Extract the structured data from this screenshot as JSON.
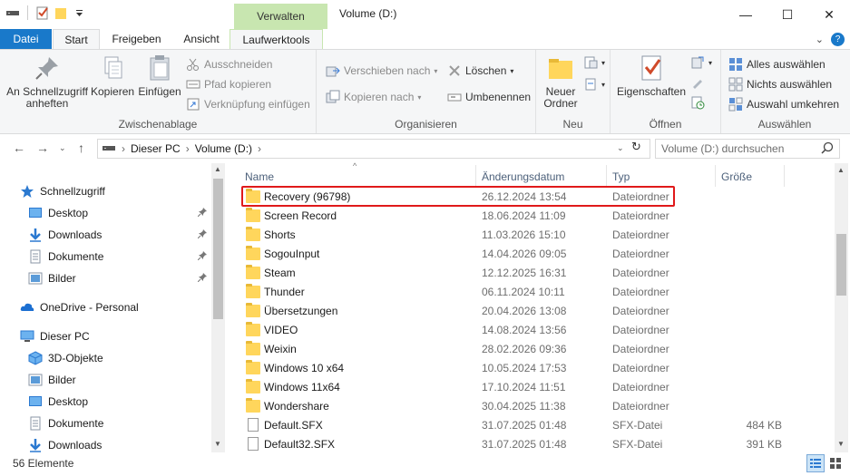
{
  "window": {
    "title": "Volume (D:)",
    "tool_tab": "Verwalten",
    "minimize": "—",
    "maximize": "☐",
    "close": "✕"
  },
  "tabs": {
    "file": "Datei",
    "start": "Start",
    "share": "Freigeben",
    "view": "Ansicht",
    "drive_tools": "Laufwerktools"
  },
  "ribbon": {
    "clipboard": {
      "label": "Zwischenablage",
      "pin": "An Schnellzugriff anheften",
      "copy": "Kopieren",
      "paste": "Einfügen",
      "cut": "Ausschneiden",
      "copy_path": "Pfad kopieren",
      "paste_shortcut": "Verknüpfung einfügen"
    },
    "organize": {
      "label": "Organisieren",
      "move_to": "Verschieben nach",
      "copy_to": "Kopieren nach",
      "delete": "Löschen",
      "rename": "Umbenennen"
    },
    "new": {
      "label": "Neu",
      "new_folder": "Neuer Ordner"
    },
    "open": {
      "label": "Öffnen",
      "properties": "Eigenschaften"
    },
    "select": {
      "label": "Auswählen",
      "select_all": "Alles auswählen",
      "select_none": "Nichts auswählen",
      "invert": "Auswahl umkehren"
    }
  },
  "address": {
    "crumb_pc": "Dieser PC",
    "crumb_sep": "›",
    "crumb_drive": "Volume (D:)",
    "search_placeholder": "Volume (D:) durchsuchen"
  },
  "nav": {
    "quick_access": "Schnellzugriff",
    "qa_items": [
      "Desktop",
      "Downloads",
      "Dokumente",
      "Bilder"
    ],
    "onedrive": "OneDrive - Personal",
    "this_pc": "Dieser PC",
    "pc_items": [
      "3D-Objekte",
      "Bilder",
      "Desktop",
      "Dokumente",
      "Downloads"
    ]
  },
  "columns": {
    "name": "Name",
    "date": "Änderungsdatum",
    "type": "Typ",
    "size": "Größe"
  },
  "files": [
    {
      "name": "Recovery (96798)",
      "date": "26.12.2024 13:54",
      "type": "Dateiordner",
      "size": "",
      "kind": "folder"
    },
    {
      "name": "Screen Record",
      "date": "18.06.2024 11:09",
      "type": "Dateiordner",
      "size": "",
      "kind": "folder"
    },
    {
      "name": "Shorts",
      "date": "11.03.2026 15:10",
      "type": "Dateiordner",
      "size": "",
      "kind": "folder"
    },
    {
      "name": "SogouInput",
      "date": "14.04.2026 09:05",
      "type": "Dateiordner",
      "size": "",
      "kind": "folder"
    },
    {
      "name": "Steam",
      "date": "12.12.2025 16:31",
      "type": "Dateiordner",
      "size": "",
      "kind": "folder"
    },
    {
      "name": "Thunder",
      "date": "06.11.2024 10:11",
      "type": "Dateiordner",
      "size": "",
      "kind": "folder"
    },
    {
      "name": "Übersetzungen",
      "date": "20.04.2026 13:08",
      "type": "Dateiordner",
      "size": "",
      "kind": "folder"
    },
    {
      "name": "VIDEO",
      "date": "14.08.2024 13:56",
      "type": "Dateiordner",
      "size": "",
      "kind": "folder"
    },
    {
      "name": "Weixin",
      "date": "28.02.2026 09:36",
      "type": "Dateiordner",
      "size": "",
      "kind": "folder"
    },
    {
      "name": "Windows 10 x64",
      "date": "10.05.2024 17:53",
      "type": "Dateiordner",
      "size": "",
      "kind": "folder"
    },
    {
      "name": "Windows 11x64",
      "date": "17.10.2024 11:51",
      "type": "Dateiordner",
      "size": "",
      "kind": "folder"
    },
    {
      "name": "Wondershare",
      "date": "30.04.2025 11:38",
      "type": "Dateiordner",
      "size": "",
      "kind": "folder"
    },
    {
      "name": "Default.SFX",
      "date": "31.07.2025 01:48",
      "type": "SFX-Datei",
      "size": "484 KB",
      "kind": "file"
    },
    {
      "name": "Default32.SFX",
      "date": "31.07.2025 01:48",
      "type": "SFX-Datei",
      "size": "391 KB",
      "kind": "file"
    }
  ],
  "status": {
    "count": "56 Elemente"
  },
  "colors": {
    "file_tab": "#1979ca",
    "tool_tab": "#c8e6b0",
    "highlight": "#e0191a",
    "folder": "#ffd65c"
  },
  "icons": {
    "quick_access": "star-icon",
    "onedrive": "cloud-icon",
    "this_pc": "monitor-icon",
    "folder": "folder-icon",
    "file": "document-icon"
  }
}
